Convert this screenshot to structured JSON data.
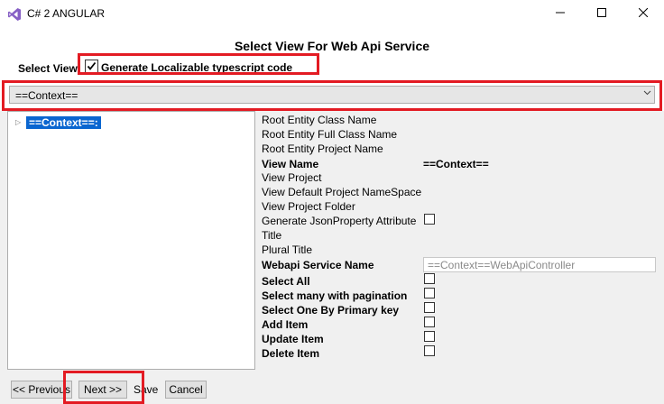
{
  "window": {
    "title": "C# 2 ANGULAR",
    "icon": "visual-studio-icon",
    "minimize_glyph": "—",
    "maximize_glyph": "☐",
    "close_glyph": "✕"
  },
  "heading": "Select View For Web Api Service",
  "select_view": {
    "label": "Select View",
    "checkbox_label": "Generate Localizable typescript code",
    "checked": true
  },
  "dropdown": {
    "value": "==Context==",
    "arrow_glyph": "⌄"
  },
  "tree": {
    "expander_glyph": "▷",
    "node_label": "==Context==:"
  },
  "properties": {
    "root_entity_class_name": "Root Entity Class Name",
    "root_entity_full_class_name": "Root Entity Full Class Name",
    "root_entity_project_name": "Root Entity Project Name",
    "view_name_label": "View Name",
    "view_name_value": "==Context==",
    "view_project": "View Project",
    "view_default_project_namespace": "View Default Project NameSpace",
    "view_project_folder": "View Project Folder",
    "generate_jsonproperty_attribute": "Generate JsonProperty Attribute",
    "title": "Title",
    "plural_title": "Plural Title",
    "webapi_service_name_label": "Webapi Service Name",
    "webapi_service_name_value": "==Context==WebApiController",
    "select_all": "Select All",
    "select_many_with_pagination": "Select many with pagination",
    "select_one_by_primary_key": "Select One By Primary key",
    "add_item": "Add Item",
    "update_item": "Update Item",
    "delete_item": "Delete Item"
  },
  "footer": {
    "previous_label": "<< Previous",
    "next_label": "Next >>",
    "save_label": "Save",
    "cancel_label": "Cancel"
  },
  "colors": {
    "highlight_red": "#e31b23",
    "selection_blue": "#0a66d0",
    "vs_purple": "#865fc5"
  }
}
